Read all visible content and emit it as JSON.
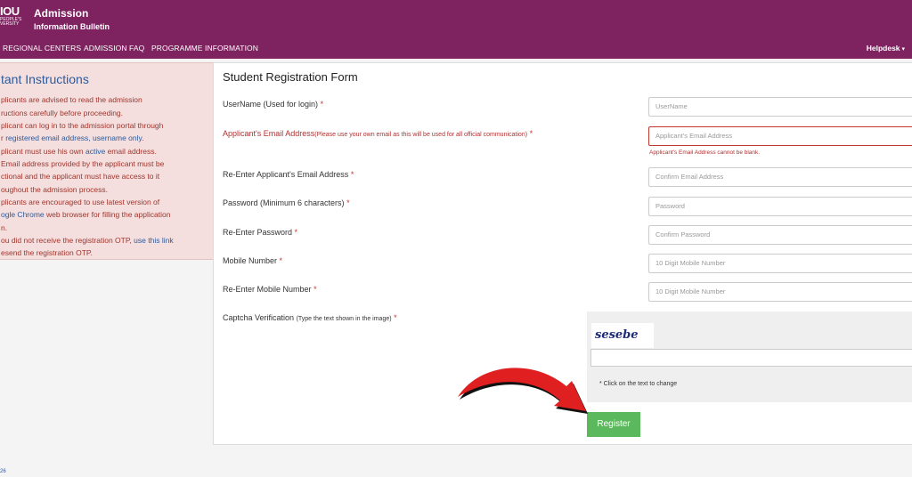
{
  "header": {
    "logo_main": "IOU",
    "logo_line2": "PEOPLE'S",
    "logo_line3": "VERSITY",
    "title": "Admission",
    "subtitle": "Information Bulletin"
  },
  "nav": {
    "items": [
      "REGIONAL CENTERS",
      "ADMISSION FAQ",
      "PROGRAMME INFORMATION"
    ],
    "helpdesk": "Helpdesk"
  },
  "instructions": {
    "title": "tant Instructions",
    "lines": [
      "plicants are advised to read the admission",
      "ructions carefully before proceeding.",
      "plicant can log in to the admission portal through",
      "r",
      "registered email address, username only",
      "plicant must use his own",
      "active",
      "email address.",
      "Email address provided by the applicant must be",
      "ctional and the applicant must have access to it",
      "oughout the admission process.",
      "plicants are encouraged to use latest version of",
      "ogle Chrome",
      "web browser for filling the application",
      "n.",
      "ou did not receive the registration OTP,",
      "use this link",
      "esend the registration OTP."
    ]
  },
  "form": {
    "title": "Student Registration Form",
    "username_label": "UserName (Used for login)",
    "email_label": "Applicant's Email Address",
    "email_note": "(Please use your own email as this will be used for all official communication)",
    "reemail_label": "Re-Enter Applicant's Email Address",
    "password_label": "Password (Minimum 6 characters)",
    "repassword_label": "Re-Enter Password",
    "mobile_label": "Mobile Number",
    "remobile_label": "Re-Enter Mobile Number",
    "captcha_label": "Captcha Verification",
    "captcha_note_label": "(Type the text shown in the image)",
    "required_mark": "*",
    "username_ph": "UserName",
    "email_ph": "Applicant's Email Address",
    "email_error": "Applicant's Email Address cannot be blank.",
    "reemail_ph": "Confirm Email Address",
    "password_ph": "Password",
    "repassword_ph": "Confirm Password",
    "mobile_ph": "10 Digit Mobile Number",
    "remobile_ph": "10 Digit Mobile Number",
    "captcha_text": "sesebe",
    "captcha_hint": "* Click on the text to change",
    "register_label": "Register"
  },
  "footer": {
    "text": "26"
  },
  "colors": {
    "header_bg": "#7e2260",
    "register_bg": "#5cb85c",
    "error": "#c0392b",
    "arrow": "#e02020"
  }
}
